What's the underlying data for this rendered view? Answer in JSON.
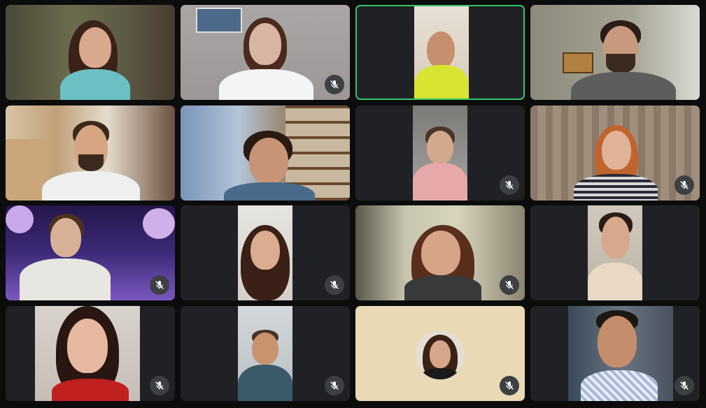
{
  "app": {
    "view": "gallery",
    "accent_color": "#34c46a",
    "tile_background": "#202124",
    "mute_button_color": "#3c4043"
  },
  "participants": [
    {
      "row": 1,
      "col": 1,
      "camera": "on",
      "mic": "unmuted",
      "active_speaker": false
    },
    {
      "row": 1,
      "col": 2,
      "camera": "on",
      "mic": "muted",
      "active_speaker": false
    },
    {
      "row": 1,
      "col": 3,
      "camera": "on",
      "mic": "unmuted",
      "active_speaker": true
    },
    {
      "row": 1,
      "col": 4,
      "camera": "on",
      "mic": "unmuted",
      "active_speaker": false
    },
    {
      "row": 2,
      "col": 1,
      "camera": "on",
      "mic": "unmuted",
      "active_speaker": false
    },
    {
      "row": 2,
      "col": 2,
      "camera": "on",
      "mic": "unmuted",
      "active_speaker": false
    },
    {
      "row": 2,
      "col": 3,
      "camera": "on",
      "mic": "muted",
      "active_speaker": false
    },
    {
      "row": 2,
      "col": 4,
      "camera": "on",
      "mic": "muted",
      "active_speaker": false
    },
    {
      "row": 3,
      "col": 1,
      "camera": "on",
      "mic": "muted",
      "active_speaker": false
    },
    {
      "row": 3,
      "col": 2,
      "camera": "on",
      "mic": "muted",
      "active_speaker": false
    },
    {
      "row": 3,
      "col": 3,
      "camera": "on",
      "mic": "muted",
      "active_speaker": false
    },
    {
      "row": 3,
      "col": 4,
      "camera": "on",
      "mic": "unmuted",
      "active_speaker": false
    },
    {
      "row": 4,
      "col": 1,
      "camera": "on",
      "mic": "muted",
      "active_speaker": false
    },
    {
      "row": 4,
      "col": 2,
      "camera": "on",
      "mic": "muted",
      "active_speaker": false
    },
    {
      "row": 4,
      "col": 3,
      "camera": "off",
      "mic": "muted",
      "active_speaker": false
    },
    {
      "row": 4,
      "col": 4,
      "camera": "on",
      "mic": "muted",
      "active_speaker": false
    }
  ],
  "icons": {
    "mute": "microphone-muted-icon"
  }
}
